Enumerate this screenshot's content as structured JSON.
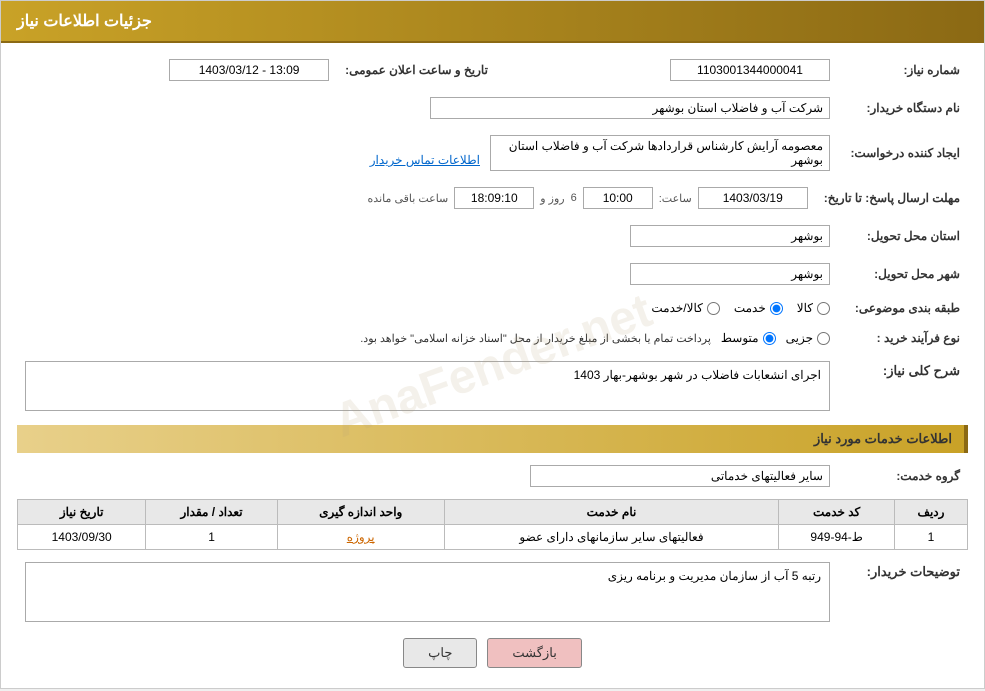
{
  "page": {
    "title": "جزئیات اطلاعات نیاز",
    "watermark": "AnaFender.net"
  },
  "header": {
    "title": "جزئیات اطلاعات نیاز"
  },
  "fields": {
    "need_number_label": "شماره نیاز:",
    "need_number_value": "1103001344000041",
    "announcement_date_label": "تاریخ و ساعت اعلان عمومی:",
    "announcement_date_value": "1403/03/12 - 13:09",
    "buyer_org_label": "نام دستگاه خریدار:",
    "buyer_org_value": "شرکت آب و فاضلاب استان بوشهر",
    "creator_label": "ایجاد کننده درخواست:",
    "creator_value": "معصومه آرایش کارشناس قراردادها شرکت آب و فاضلاب استان بوشهر",
    "creator_link": "اطلاعات تماس خریدار",
    "response_deadline_label": "مهلت ارسال پاسخ: تا تاریخ:",
    "response_date_value": "1403/03/19",
    "response_time_label": "ساعت:",
    "response_time_value": "10:00",
    "response_day_label": "روز و",
    "response_days_value": "6",
    "response_remaining_label": "ساعت باقی مانده",
    "response_remaining_value": "18:09:10",
    "province_label": "استان محل تحویل:",
    "province_value": "بوشهر",
    "city_label": "شهر محل تحویل:",
    "city_value": "بوشهر",
    "category_label": "طبقه بندی موضوعی:",
    "category_options": [
      {
        "label": "کالا",
        "value": "kala"
      },
      {
        "label": "خدمت",
        "value": "khedmat"
      },
      {
        "label": "کالا/خدمت",
        "value": "kala_khedmat"
      }
    ],
    "category_selected": "khedmat",
    "process_label": "نوع فرآیند خرید :",
    "process_options": [
      {
        "label": "جزیی",
        "value": "jozi"
      },
      {
        "label": "متوسط",
        "value": "motevaset"
      }
    ],
    "process_selected": "motevaset",
    "process_note": "پرداخت تمام یا بخشی از مبلغ خریدار از محل \"اسناد خزانه اسلامی\" خواهد بود.",
    "need_description_label": "شرح کلی نیاز:",
    "need_description_value": "اجرای انشعابات فاضلاب در شهر بوشهر-بهار 1403",
    "services_section_label": "اطلاعات خدمات مورد نیاز",
    "service_group_label": "گروه خدمت:",
    "service_group_value": "سایر فعالیتهای خدماتی",
    "services_table": {
      "headers": [
        "ردیف",
        "کد خدمت",
        "نام خدمت",
        "واحد اندازه گیری",
        "تعداد / مقدار",
        "تاریخ نیاز"
      ],
      "rows": [
        {
          "row": "1",
          "code": "ط-94-949",
          "name": "فعالیتهای سایر سازمانهای دارای عضو",
          "unit": "پروژه",
          "quantity": "1",
          "date": "1403/09/30"
        }
      ]
    },
    "buyer_notes_label": "توضیحات خریدار:",
    "buyer_notes_value": "رتبه 5 آب از سازمان مدیریت و برنامه ریزی"
  },
  "buttons": {
    "print": "چاپ",
    "back": "بازگشت"
  }
}
